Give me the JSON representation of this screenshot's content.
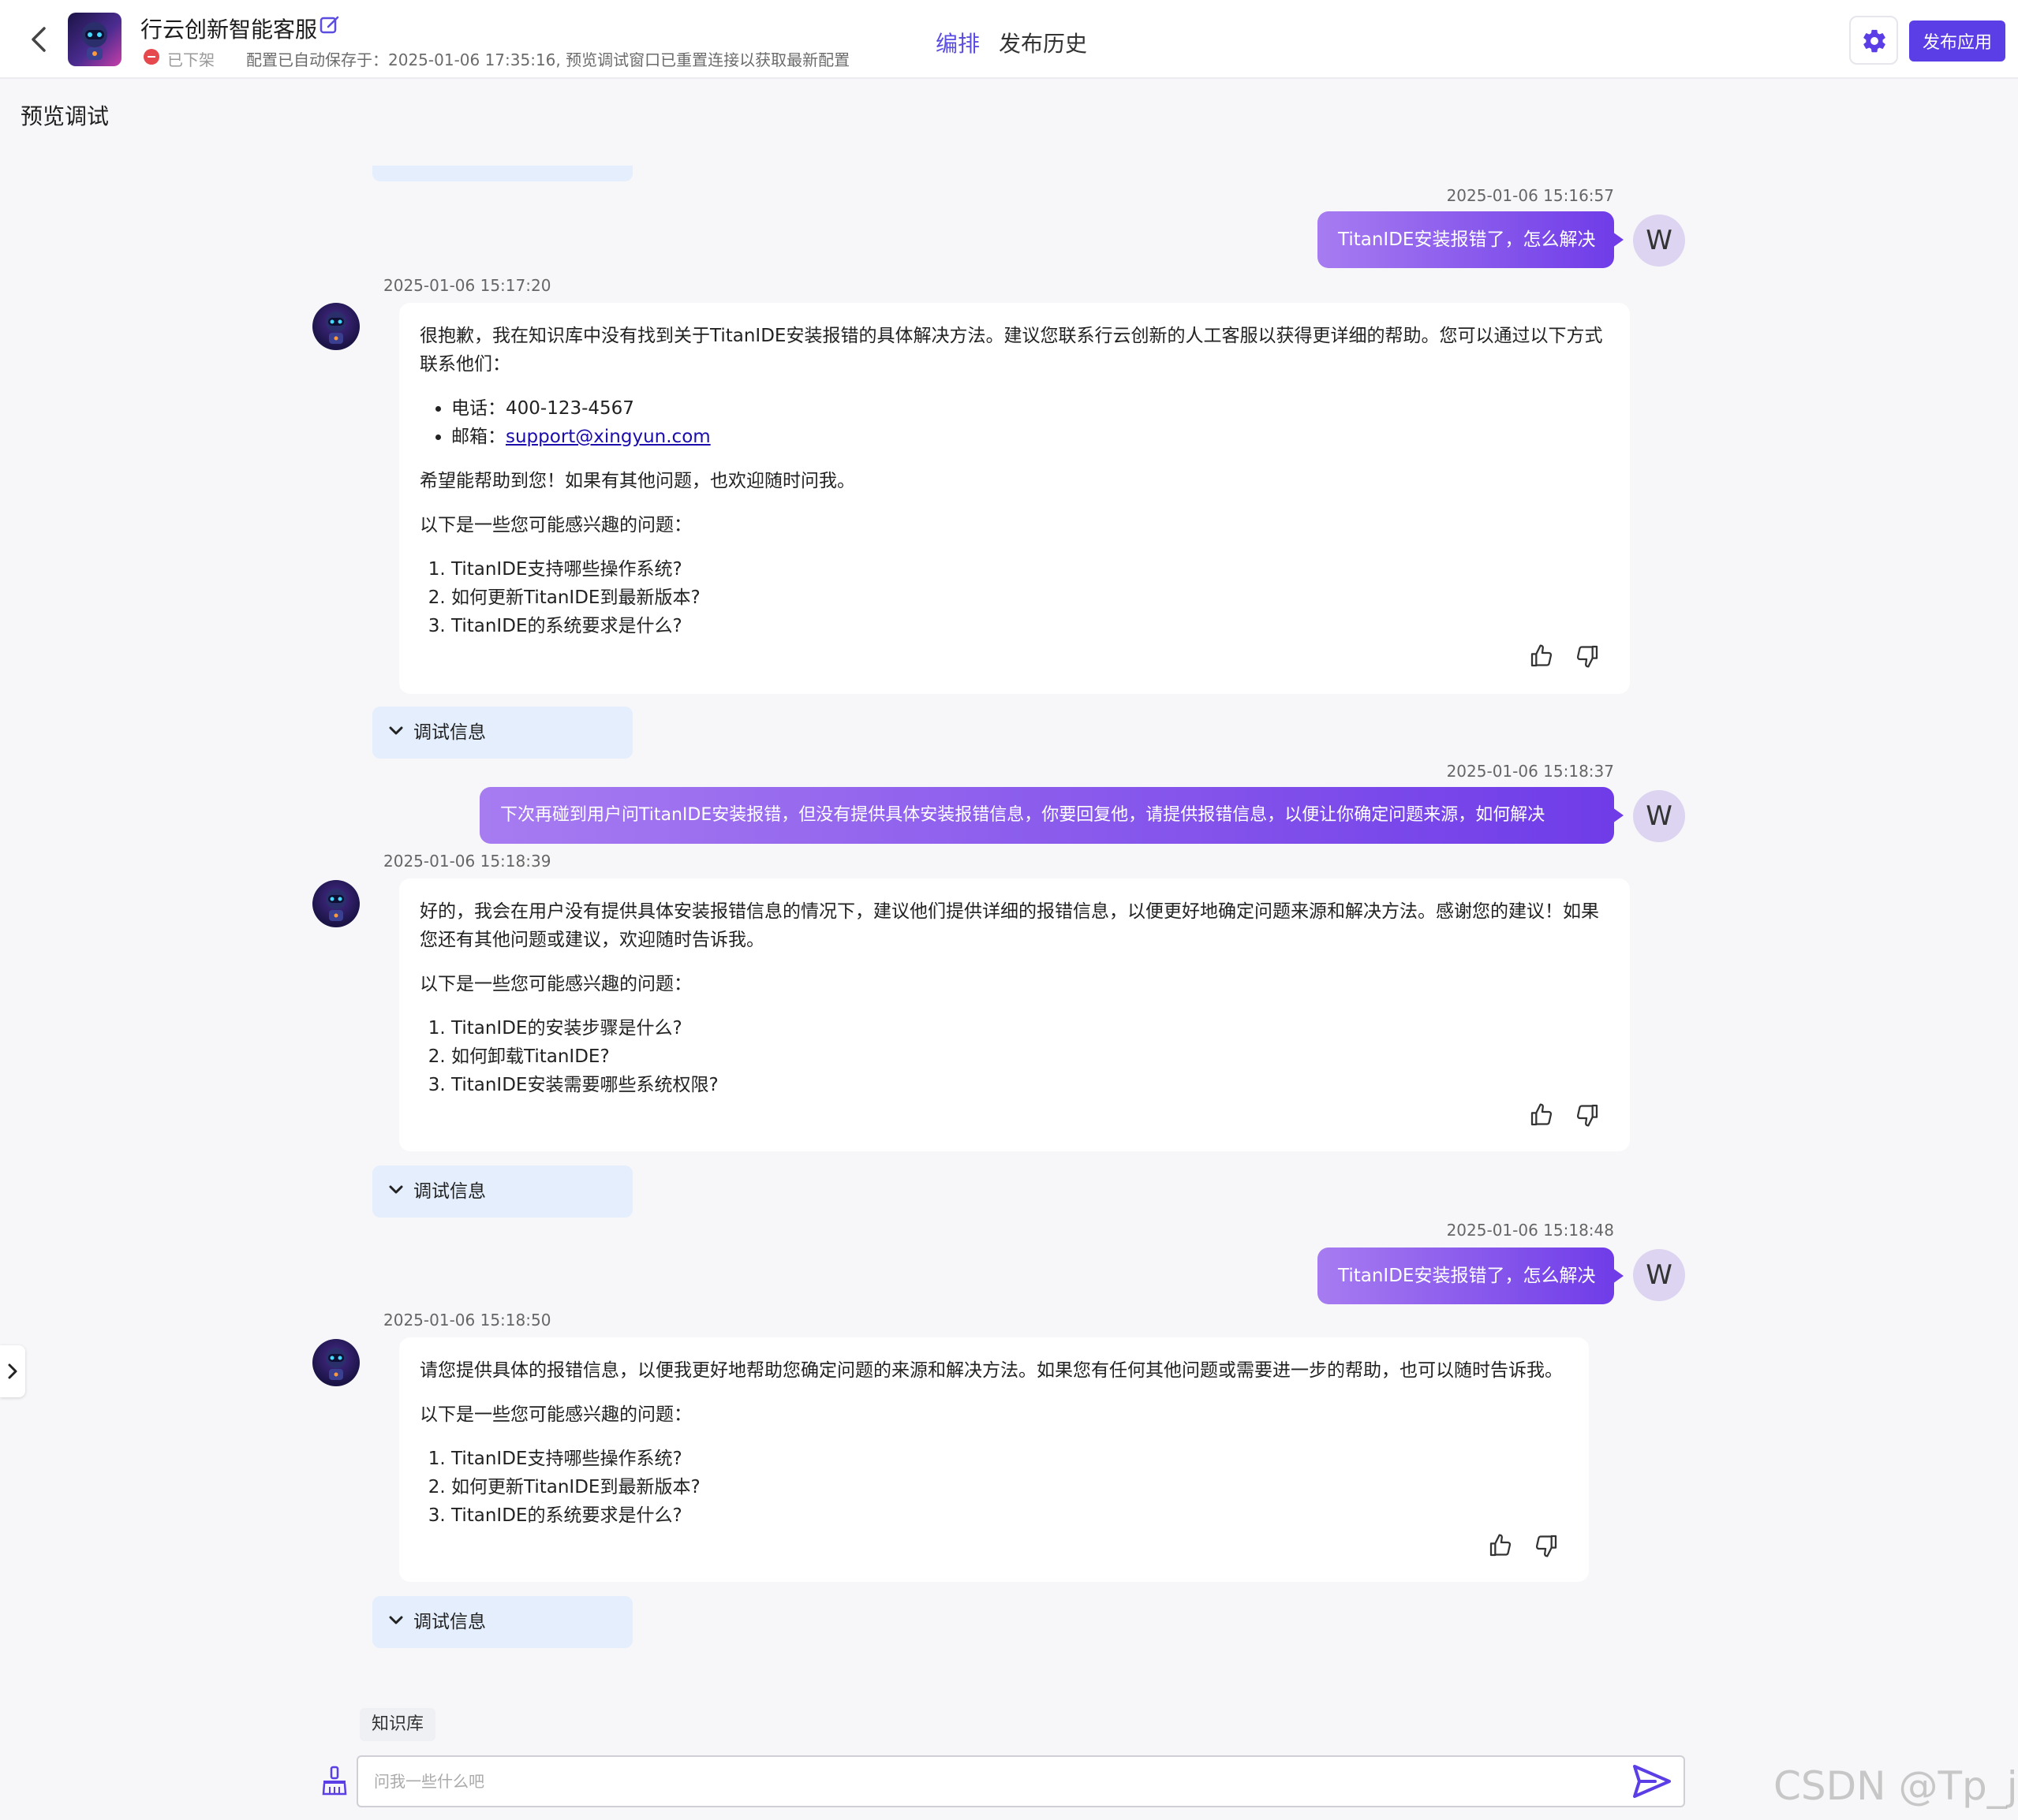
{
  "header": {
    "app_title": "行云创新智能客服",
    "status": "已下架",
    "autosave": "配置已自动保存于：2025-01-06 17:35:16, 预览调试窗口已重置连接以获取最新配置",
    "tabs": [
      {
        "label": "编排",
        "active": true
      },
      {
        "label": "发布历史",
        "active": false
      }
    ],
    "publish_label": "发布应用"
  },
  "page_title": "预览调试",
  "accent_color": "#5b3ee6",
  "messages": [
    {
      "role": "user",
      "timestamp": "2025-01-06 15:16:57",
      "text": "TitanIDE安装报错了，怎么解决",
      "avatar": "W"
    },
    {
      "role": "bot",
      "timestamp": "2025-01-06 15:17:20",
      "intro": "很抱歉，我在知识库中没有找到关于TitanIDE安装报错的具体解决方法。建议您联系行云创新的人工客服以获得更详细的帮助。您可以通过以下方式联系他们：",
      "contacts": [
        {
          "label": "电话：",
          "value": "400-123-4567"
        },
        {
          "label": "邮箱：",
          "value": "support@xingyun.com"
        }
      ],
      "closing": "希望能帮助到您！如果有其他问题，也欢迎随时问我。",
      "suggest_header": "以下是一些您可能感兴趣的问题：",
      "suggestions": [
        "TitanIDE支持哪些操作系统?",
        "如何更新TitanIDE到最新版本?",
        "TitanIDE的系统要求是什么?"
      ],
      "debug_label": "调试信息"
    },
    {
      "role": "user",
      "timestamp": "2025-01-06 15:18:37",
      "text": "下次再碰到用户问TitanIDE安装报错，但没有提供具体安装报错信息，你要回复他，请提供报错信息，以便让你确定问题来源，如何解决",
      "avatar": "W"
    },
    {
      "role": "bot",
      "timestamp": "2025-01-06 15:18:39",
      "intro": "好的，我会在用户没有提供具体安装报错信息的情况下，建议他们提供详细的报错信息，以便更好地确定问题来源和解决方法。感谢您的建议！如果您还有其他问题或建议，欢迎随时告诉我。",
      "suggest_header": "以下是一些您可能感兴趣的问题：",
      "suggestions": [
        "TitanIDE的安装步骤是什么?",
        "如何卸载TitanIDE?",
        "TitanIDE安装需要哪些系统权限?"
      ],
      "debug_label": "调试信息"
    },
    {
      "role": "user",
      "timestamp": "2025-01-06 15:18:48",
      "text": "TitanIDE安装报错了，怎么解决",
      "avatar": "W"
    },
    {
      "role": "bot",
      "timestamp": "2025-01-06 15:18:50",
      "intro": "请您提供具体的报错信息，以便我更好地帮助您确定问题的来源和解决方法。如果您有任何其他问题或需要进一步的帮助，也可以随时告诉我。",
      "suggest_header": "以下是一些您可能感兴趣的问题：",
      "suggestions": [
        "TitanIDE支持哪些操作系统?",
        "如何更新TitanIDE到最新版本?",
        "TitanIDE的系统要求是什么?"
      ],
      "debug_label": "调试信息"
    }
  ],
  "knowledge_tag": "知识库",
  "input": {
    "placeholder": "问我一些什么吧",
    "value": ""
  },
  "watermark": "CSDN @Tp_jh",
  "icons": {
    "back": "back-arrow-icon",
    "edit": "edit-icon",
    "settings": "gear-icon",
    "like": "thumbs-up-icon",
    "dislike": "thumbs-down-icon",
    "expand": "chevron-down-icon",
    "clear": "broom-icon",
    "send": "send-icon"
  }
}
